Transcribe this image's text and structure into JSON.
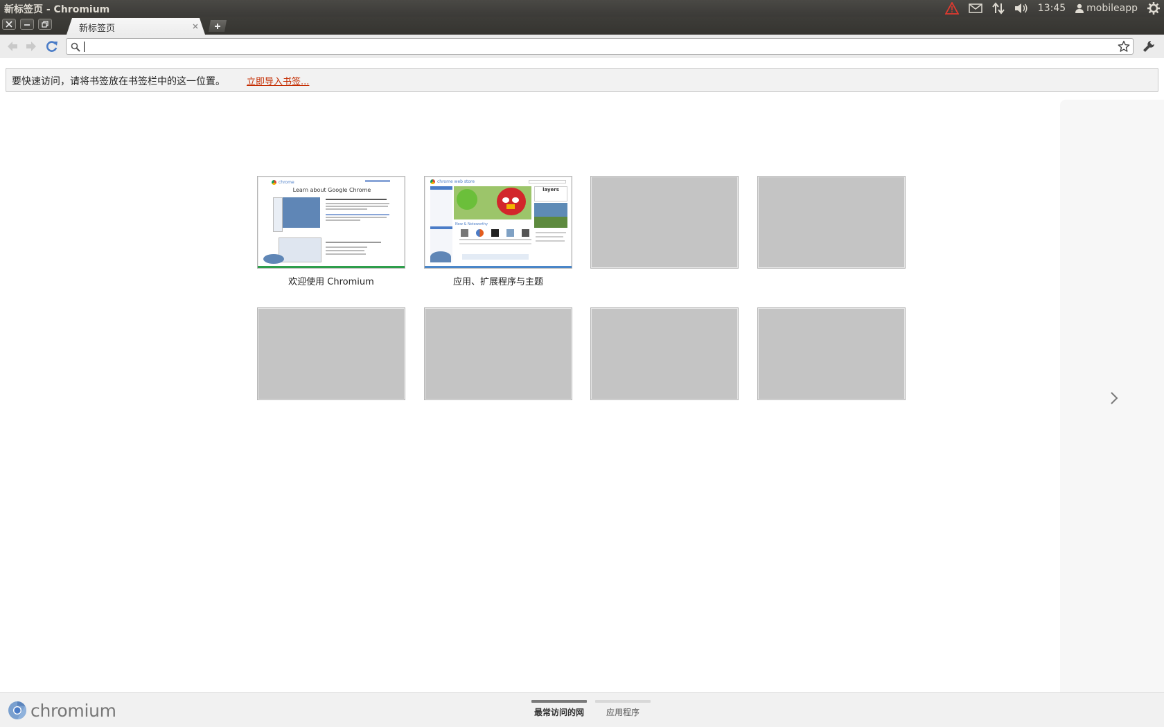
{
  "top_panel": {
    "window_title": "新标签页 - Chromium",
    "time": "13:45",
    "user": "mobileapp",
    "indicator_icons": [
      "warning-icon",
      "mail-icon",
      "network-icon",
      "volume-icon",
      "user-icon",
      "gear-icon"
    ]
  },
  "tab": {
    "title": "新标签页"
  },
  "toolbar": {
    "omnibox_value": ""
  },
  "bookmark_bar": {
    "promo_text": "要快速访问，请将书签放在书签栏中的这一位置。",
    "import_link": "立即导入书签..."
  },
  "most_visited": [
    {
      "title": "欢迎使用 Chromium",
      "thumb_heading": "Learn about Google Chrome",
      "brand": "chrome"
    },
    {
      "title": "应用、扩展程序与主题",
      "brand": "chrome web store",
      "promo": "layers",
      "section": "New & Noteworthy"
    },
    {
      "title": ""
    },
    {
      "title": ""
    },
    {
      "title": ""
    },
    {
      "title": ""
    },
    {
      "title": ""
    },
    {
      "title": ""
    }
  ],
  "footer": {
    "logo_text": "chromium",
    "tabs": [
      {
        "label": "最常访问的网",
        "active": true
      },
      {
        "label": "应用程序",
        "active": false
      }
    ]
  },
  "colors": {
    "panel_bg": "#3c3b37",
    "link": "#c42c00",
    "tile_empty": "#c4c4c4",
    "warning": "#e03a2f"
  }
}
